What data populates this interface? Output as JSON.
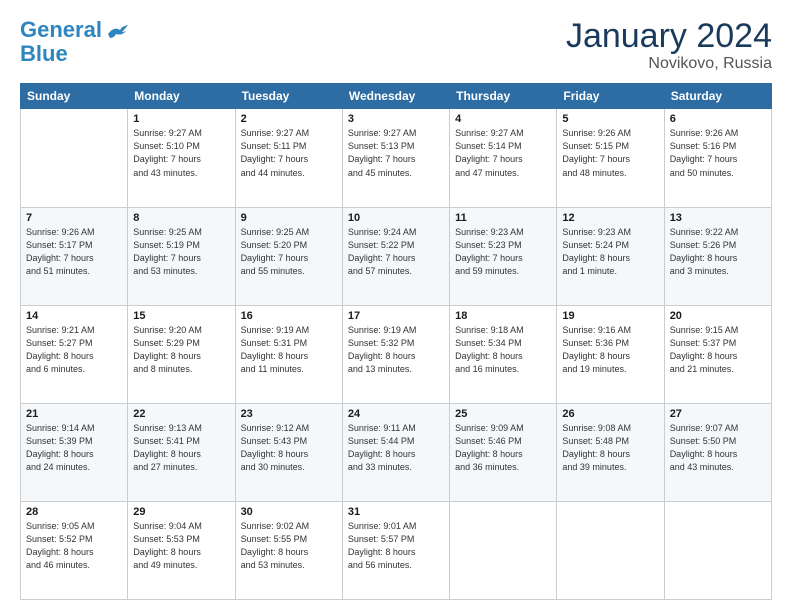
{
  "logo": {
    "line1": "General",
    "line2": "Blue"
  },
  "title": "January 2024",
  "subtitle": "Novikovo, Russia",
  "days_header": [
    "Sunday",
    "Monday",
    "Tuesday",
    "Wednesday",
    "Thursday",
    "Friday",
    "Saturday"
  ],
  "weeks": [
    [
      {
        "day": "",
        "info": ""
      },
      {
        "day": "1",
        "info": "Sunrise: 9:27 AM\nSunset: 5:10 PM\nDaylight: 7 hours\nand 43 minutes."
      },
      {
        "day": "2",
        "info": "Sunrise: 9:27 AM\nSunset: 5:11 PM\nDaylight: 7 hours\nand 44 minutes."
      },
      {
        "day": "3",
        "info": "Sunrise: 9:27 AM\nSunset: 5:13 PM\nDaylight: 7 hours\nand 45 minutes."
      },
      {
        "day": "4",
        "info": "Sunrise: 9:27 AM\nSunset: 5:14 PM\nDaylight: 7 hours\nand 47 minutes."
      },
      {
        "day": "5",
        "info": "Sunrise: 9:26 AM\nSunset: 5:15 PM\nDaylight: 7 hours\nand 48 minutes."
      },
      {
        "day": "6",
        "info": "Sunrise: 9:26 AM\nSunset: 5:16 PM\nDaylight: 7 hours\nand 50 minutes."
      }
    ],
    [
      {
        "day": "7",
        "info": "Sunrise: 9:26 AM\nSunset: 5:17 PM\nDaylight: 7 hours\nand 51 minutes."
      },
      {
        "day": "8",
        "info": "Sunrise: 9:25 AM\nSunset: 5:19 PM\nDaylight: 7 hours\nand 53 minutes."
      },
      {
        "day": "9",
        "info": "Sunrise: 9:25 AM\nSunset: 5:20 PM\nDaylight: 7 hours\nand 55 minutes."
      },
      {
        "day": "10",
        "info": "Sunrise: 9:24 AM\nSunset: 5:22 PM\nDaylight: 7 hours\nand 57 minutes."
      },
      {
        "day": "11",
        "info": "Sunrise: 9:23 AM\nSunset: 5:23 PM\nDaylight: 7 hours\nand 59 minutes."
      },
      {
        "day": "12",
        "info": "Sunrise: 9:23 AM\nSunset: 5:24 PM\nDaylight: 8 hours\nand 1 minute."
      },
      {
        "day": "13",
        "info": "Sunrise: 9:22 AM\nSunset: 5:26 PM\nDaylight: 8 hours\nand 3 minutes."
      }
    ],
    [
      {
        "day": "14",
        "info": "Sunrise: 9:21 AM\nSunset: 5:27 PM\nDaylight: 8 hours\nand 6 minutes."
      },
      {
        "day": "15",
        "info": "Sunrise: 9:20 AM\nSunset: 5:29 PM\nDaylight: 8 hours\nand 8 minutes."
      },
      {
        "day": "16",
        "info": "Sunrise: 9:19 AM\nSunset: 5:31 PM\nDaylight: 8 hours\nand 11 minutes."
      },
      {
        "day": "17",
        "info": "Sunrise: 9:19 AM\nSunset: 5:32 PM\nDaylight: 8 hours\nand 13 minutes."
      },
      {
        "day": "18",
        "info": "Sunrise: 9:18 AM\nSunset: 5:34 PM\nDaylight: 8 hours\nand 16 minutes."
      },
      {
        "day": "19",
        "info": "Sunrise: 9:16 AM\nSunset: 5:36 PM\nDaylight: 8 hours\nand 19 minutes."
      },
      {
        "day": "20",
        "info": "Sunrise: 9:15 AM\nSunset: 5:37 PM\nDaylight: 8 hours\nand 21 minutes."
      }
    ],
    [
      {
        "day": "21",
        "info": "Sunrise: 9:14 AM\nSunset: 5:39 PM\nDaylight: 8 hours\nand 24 minutes."
      },
      {
        "day": "22",
        "info": "Sunrise: 9:13 AM\nSunset: 5:41 PM\nDaylight: 8 hours\nand 27 minutes."
      },
      {
        "day": "23",
        "info": "Sunrise: 9:12 AM\nSunset: 5:43 PM\nDaylight: 8 hours\nand 30 minutes."
      },
      {
        "day": "24",
        "info": "Sunrise: 9:11 AM\nSunset: 5:44 PM\nDaylight: 8 hours\nand 33 minutes."
      },
      {
        "day": "25",
        "info": "Sunrise: 9:09 AM\nSunset: 5:46 PM\nDaylight: 8 hours\nand 36 minutes."
      },
      {
        "day": "26",
        "info": "Sunrise: 9:08 AM\nSunset: 5:48 PM\nDaylight: 8 hours\nand 39 minutes."
      },
      {
        "day": "27",
        "info": "Sunrise: 9:07 AM\nSunset: 5:50 PM\nDaylight: 8 hours\nand 43 minutes."
      }
    ],
    [
      {
        "day": "28",
        "info": "Sunrise: 9:05 AM\nSunset: 5:52 PM\nDaylight: 8 hours\nand 46 minutes."
      },
      {
        "day": "29",
        "info": "Sunrise: 9:04 AM\nSunset: 5:53 PM\nDaylight: 8 hours\nand 49 minutes."
      },
      {
        "day": "30",
        "info": "Sunrise: 9:02 AM\nSunset: 5:55 PM\nDaylight: 8 hours\nand 53 minutes."
      },
      {
        "day": "31",
        "info": "Sunrise: 9:01 AM\nSunset: 5:57 PM\nDaylight: 8 hours\nand 56 minutes."
      },
      {
        "day": "",
        "info": ""
      },
      {
        "day": "",
        "info": ""
      },
      {
        "day": "",
        "info": ""
      }
    ]
  ]
}
